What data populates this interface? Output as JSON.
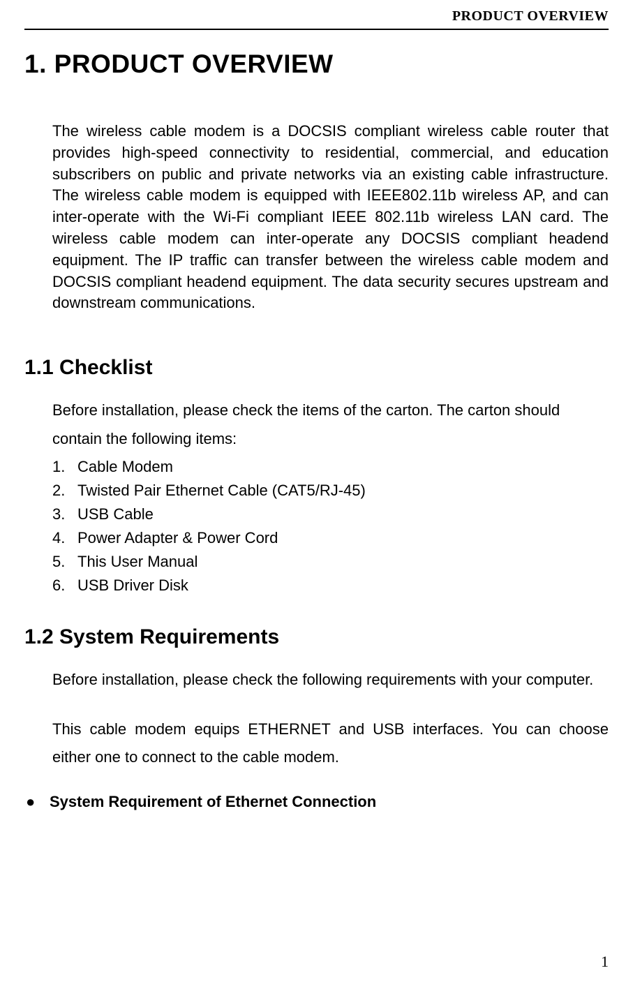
{
  "header": {
    "running_title": "PRODUCT OVERVIEW"
  },
  "section1": {
    "heading": "1. PRODUCT OVERVIEW",
    "paragraph": "The wireless cable modem is a DOCSIS compliant wireless cable router that provides high-speed connectivity to residential, commercial, and education subscribers on public and private networks via an existing cable infrastructure. The wireless cable modem is equipped with IEEE802.11b wireless AP, and can inter-operate with the Wi-Fi compliant IEEE 802.11b wireless LAN card. The wireless cable modem can inter-operate any DOCSIS compliant headend equipment. The IP traffic can transfer between the wireless cable modem and DOCSIS compliant headend equipment. The data security secures upstream and downstream communications."
  },
  "section11": {
    "heading": "1.1 Checklist",
    "intro": "Before installation, please check the items of the carton. The carton should contain the following items:",
    "items": [
      {
        "num": "1.",
        "text": "Cable Modem"
      },
      {
        "num": "2.",
        "text": "Twisted Pair Ethernet Cable (CAT5/RJ-45)"
      },
      {
        "num": "3.",
        "text": "USB Cable"
      },
      {
        "num": "4.",
        "text": "Power Adapter & Power Cord"
      },
      {
        "num": "5.",
        "text": "This User Manual"
      },
      {
        "num": "6.",
        "text": "USB Driver Disk"
      }
    ]
  },
  "section12": {
    "heading": "1.2 System Requirements",
    "para1": "Before installation, please check the following requirements with your computer.",
    "para2": "This cable modem equips ETHERNET and USB interfaces. You can choose either one to connect to the cable modem.",
    "bullet_label": "System Requirement of Ethernet Connection"
  },
  "page_number": "1"
}
